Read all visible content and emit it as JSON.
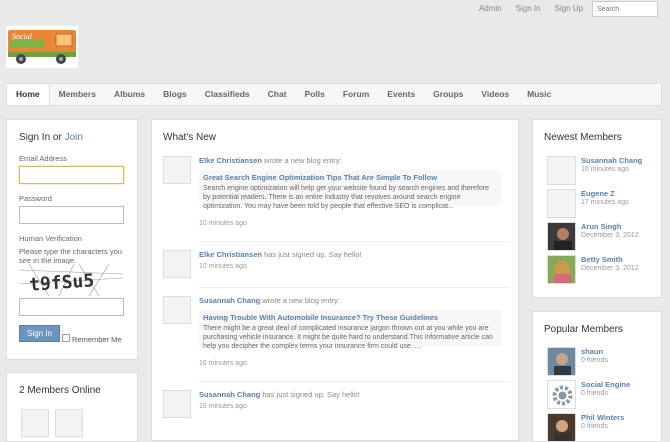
{
  "topbar": {
    "admin": "Admin",
    "signin": "Sign In",
    "signup": "Sign Up",
    "search_placeholder": "Search"
  },
  "logo": {
    "text": "Social"
  },
  "nav": {
    "tabs": [
      "Home",
      "Members",
      "Albums",
      "Blogs",
      "Classifieds",
      "Chat",
      "Polls",
      "Forum",
      "Events",
      "Groups",
      "Videos",
      "Music"
    ]
  },
  "signin": {
    "title": "Sign In or ",
    "join": "Join",
    "email_label": "Email Address",
    "password_label": "Password",
    "verification_label": "Human Verification",
    "captcha_hint": "Please type the characters you see in the image.",
    "captcha_text": "t9fSu5",
    "button": "Sign In",
    "remember": "Remember Me"
  },
  "online": {
    "title": "2 Members Online"
  },
  "whatsnew": {
    "title": "What's New",
    "items": [
      {
        "who": "Elke Christiansen",
        "what": " wrote a new blog entry:",
        "blog_title": "Great Search Engine Optimization Tips That Are Simple To Follow",
        "blog_text": "Search engine optimization will help get your website found by search engines and therefore by potential readers. There is an entire industry that revolves around search engine optimization. You may have been told by people that effective SEO is complicat...",
        "when": "10 minutes ago"
      },
      {
        "who": "Elke Christiansen",
        "what": " has just signed up. Say hello!",
        "when": "10 minutes ago"
      },
      {
        "who": "Susannah Chang",
        "what": " wrote a new blog entry:",
        "blog_title": "Having Trouble With Automobile Insurance? Try These Guidelines",
        "blog_text": "There might be a great deal of complicated insurance jargon thrown out at you while you are purchasing vehicle insurance. It might be quite hard to understand.This informative article can help you decipher the complex terms your insurance firm could use. ...",
        "when": "16 minutes ago"
      },
      {
        "who": "Susannah Chang",
        "what": " has just signed up. Say hello!",
        "when": "16 minutes ago"
      }
    ]
  },
  "newest": {
    "title": "Newest Members",
    "members": [
      {
        "name": "Susannah Chang",
        "sub": "16 minutes ago"
      },
      {
        "name": "Eugene Z",
        "sub": "17 minutes ago"
      },
      {
        "name": "Arun Singh",
        "sub": "December 3, 2012"
      },
      {
        "name": "Betty Smith",
        "sub": "December 3, 2012"
      }
    ]
  },
  "popular": {
    "title": "Popular Members",
    "members": [
      {
        "name": "shaun",
        "sub": "0 friends"
      },
      {
        "name": "Social Engine",
        "sub": "0 friends"
      },
      {
        "name": "Phil Winters",
        "sub": "0 friends"
      }
    ]
  },
  "colors": {
    "link": "#5a7fa8",
    "button": "#6b95be",
    "logo_bg": "#e8873a"
  }
}
